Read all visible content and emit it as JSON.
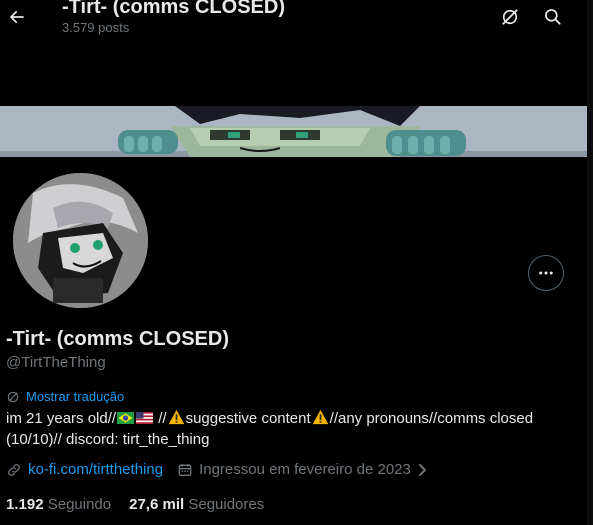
{
  "header": {
    "title": "-Tirt- (comms CLOSED)",
    "post_count": "3.579 posts"
  },
  "profile": {
    "display_name": "-Tirt- (comms CLOSED)",
    "handle": "@TirtTheThing",
    "translate_label": "Mostrar tradução",
    "bio_part1": "im 21 years old//",
    "bio_part2": " //",
    "bio_part3": "suggestive content",
    "bio_part4": "//any pronouns//comms closed (10/10)// discord: tirt_the_thing",
    "website": "ko-fi.com/tirtthething",
    "joined": "Ingressou em fevereiro de 2023"
  },
  "stats": {
    "following_count": "1.192",
    "following_label": "Seguindo",
    "followers_count": "27,6 mil",
    "followers_label": "Seguidores"
  },
  "icons": {
    "back": "back-arrow-icon",
    "grok": "grok-icon",
    "search": "search-icon",
    "more": "more-icon",
    "translate": "globe-icon",
    "link": "link-icon",
    "calendar": "calendar-icon",
    "chevron": "chevron-right-icon"
  },
  "colors": {
    "accent": "#1d9bf0",
    "text": "#e7e9ea",
    "muted": "#71767b",
    "background": "#000000"
  }
}
